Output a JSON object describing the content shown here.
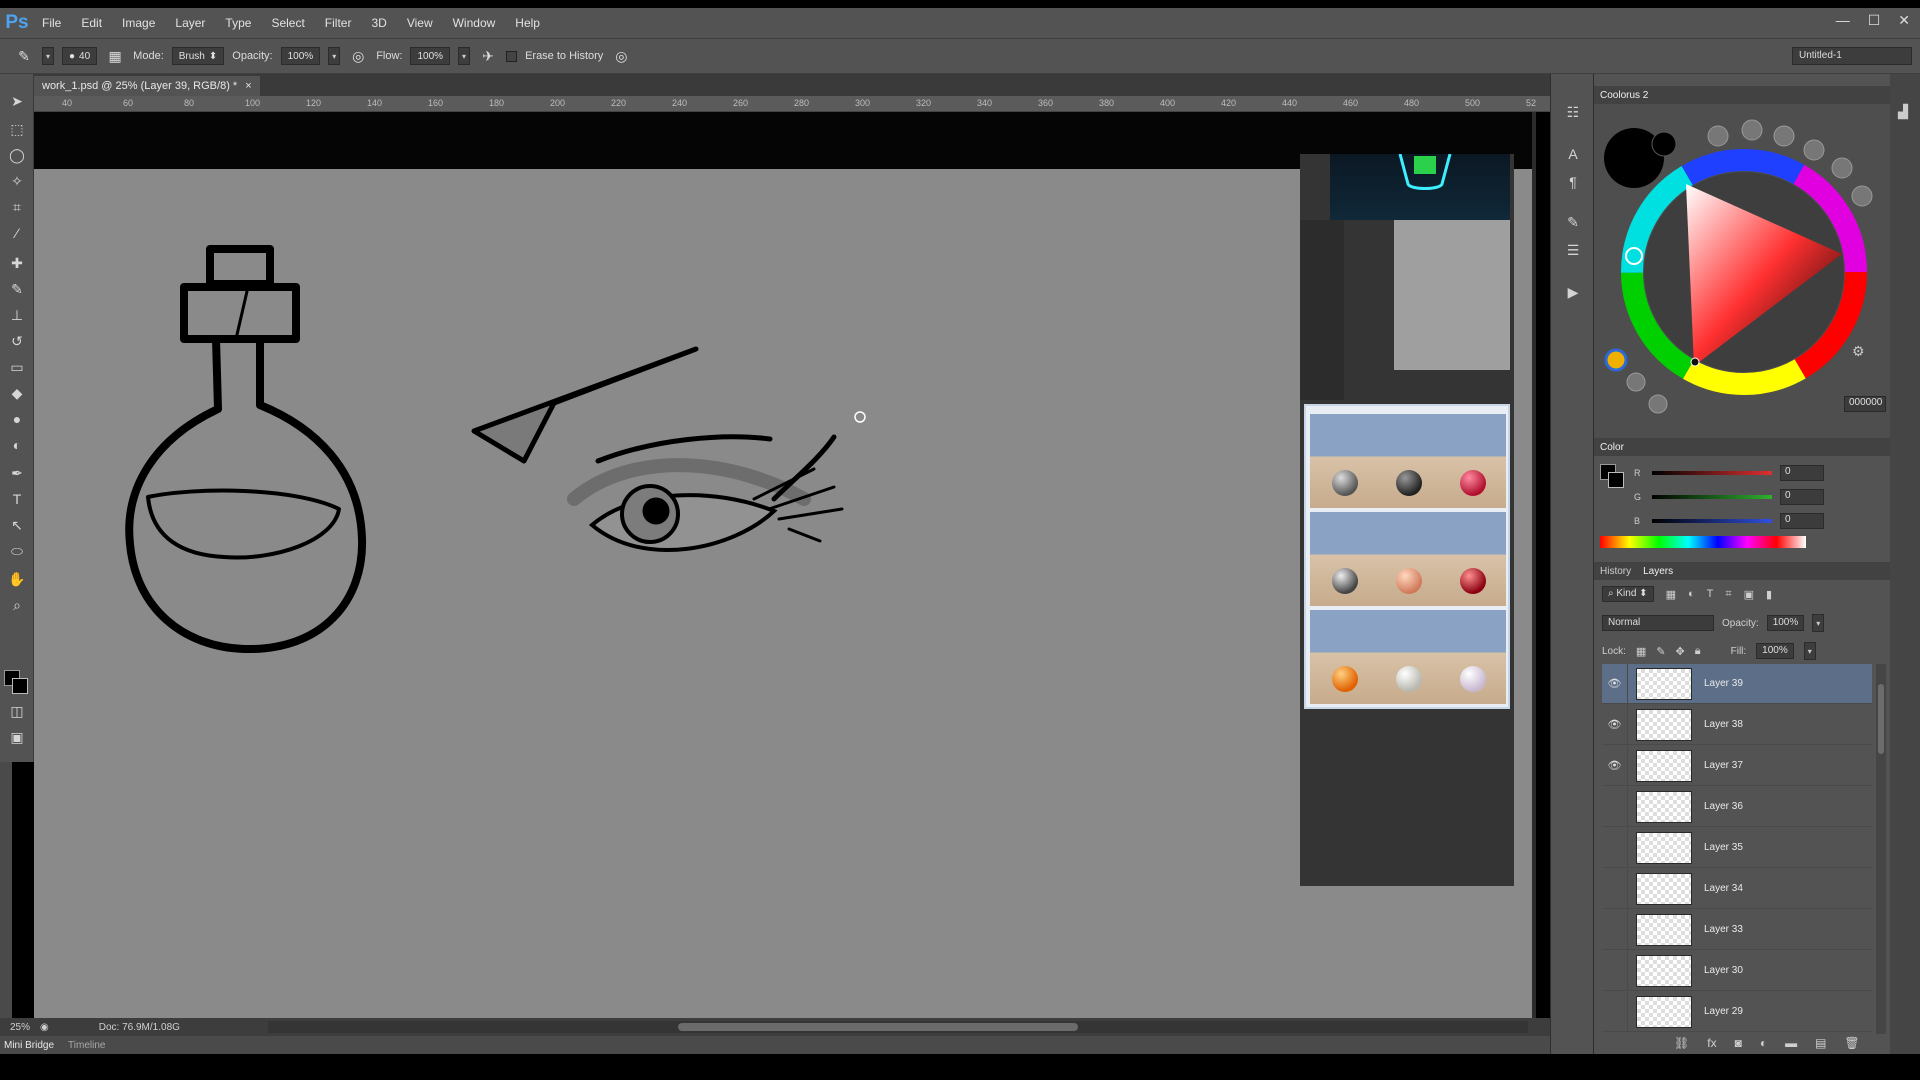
{
  "app": {
    "logo": "Ps"
  },
  "menu": [
    "File",
    "Edit",
    "Image",
    "Layer",
    "Type",
    "Select",
    "Filter",
    "3D",
    "View",
    "Window",
    "Help"
  ],
  "window_controls": [
    "—",
    "☐",
    "✕"
  ],
  "options": {
    "brush_size": "40",
    "mode_label": "Mode:",
    "mode_value": "Brush",
    "opacity_label": "Opacity:",
    "opacity_value": "100%",
    "flow_label": "Flow:",
    "flow_value": "100%",
    "erase_history_label": "Erase to History",
    "workspace": "Untitled-1"
  },
  "document": {
    "tab_title": "work_1.psd @ 25% (Layer 39, RGB/8) *",
    "tab_close": "×",
    "ruler_ticks": [
      "40",
      "60",
      "80",
      "100",
      "120",
      "140",
      "160",
      "180",
      "200",
      "220",
      "240",
      "260",
      "280",
      "300",
      "320",
      "340",
      "360",
      "380",
      "400",
      "420",
      "440",
      "460",
      "480",
      "500",
      "52"
    ]
  },
  "status": {
    "zoom": "25%",
    "doc_info": "Doc: 76.9M/1.08G"
  },
  "bottom_tabs": [
    "Mini Bridge",
    "Timeline"
  ],
  "coolorus": {
    "title": "Coolorus 2",
    "hex": "000000"
  },
  "color_panel": {
    "title": "Color",
    "channels": [
      {
        "label": "R",
        "value": "0",
        "color": "#e03030"
      },
      {
        "label": "G",
        "value": "0",
        "color": "#30b030"
      },
      {
        "label": "B",
        "value": "0",
        "color": "#3050e0"
      }
    ]
  },
  "layers_panel": {
    "tabs": [
      "History",
      "Layers"
    ],
    "kind_label": "Kind",
    "blend_mode": "Normal",
    "opacity_label": "Opacity:",
    "opacity_value": "100%",
    "lock_label": "Lock:",
    "fill_label": "Fill:",
    "fill_value": "100%",
    "layers": [
      {
        "name": "Layer 39",
        "visible": true,
        "selected": true
      },
      {
        "name": "Layer 38",
        "visible": true,
        "selected": false
      },
      {
        "name": "Layer 37",
        "visible": true,
        "selected": false
      },
      {
        "name": "Layer 36",
        "visible": false,
        "selected": false
      },
      {
        "name": "Layer 35",
        "visible": false,
        "selected": false
      },
      {
        "name": "Layer 34",
        "visible": false,
        "selected": false
      },
      {
        "name": "Layer 33",
        "visible": false,
        "selected": false
      },
      {
        "name": "Layer 30",
        "visible": false,
        "selected": false
      },
      {
        "name": "Layer 29",
        "visible": false,
        "selected": false
      }
    ]
  },
  "colors": {
    "accent": "#5d6e89",
    "panel": "#535353",
    "canvas": "#8a8a8a"
  }
}
